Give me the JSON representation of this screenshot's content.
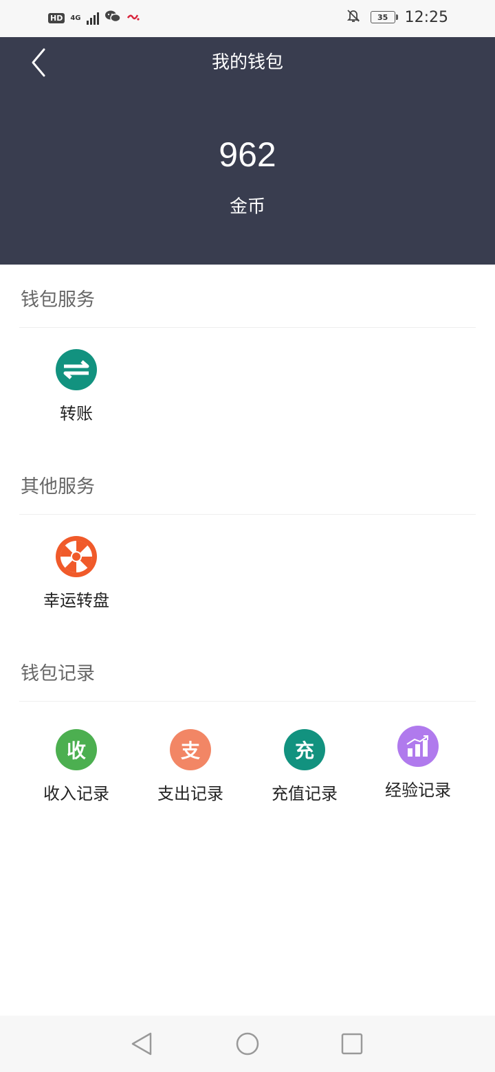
{
  "status_bar": {
    "hd": "HD",
    "network": "4G",
    "battery": "35",
    "time": "12:25"
  },
  "header": {
    "title": "我的钱包",
    "balance": "962",
    "unit": "金币"
  },
  "sections": {
    "wallet_service": {
      "title": "钱包服务",
      "items": [
        {
          "label": "转账",
          "icon": "transfer-icon",
          "color": "#12927f"
        }
      ]
    },
    "other_service": {
      "title": "其他服务",
      "items": [
        {
          "label": "幸运转盘",
          "icon": "lucky-wheel-icon",
          "color": "#f05a2a"
        }
      ]
    },
    "wallet_records": {
      "title": "钱包记录",
      "items": [
        {
          "label": "收入记录",
          "glyph": "收",
          "icon": "income-icon",
          "color": "#4caf50"
        },
        {
          "label": "支出记录",
          "glyph": "支",
          "icon": "expense-icon",
          "color": "#f28665"
        },
        {
          "label": "充值记录",
          "glyph": "充",
          "icon": "recharge-icon",
          "color": "#12927f"
        },
        {
          "label": "经验记录",
          "icon": "chart-icon",
          "color": "#b07aed"
        }
      ]
    }
  },
  "colors": {
    "header_bg": "#393d4f",
    "section_title": "#666666",
    "divider": "#eeeeee"
  }
}
